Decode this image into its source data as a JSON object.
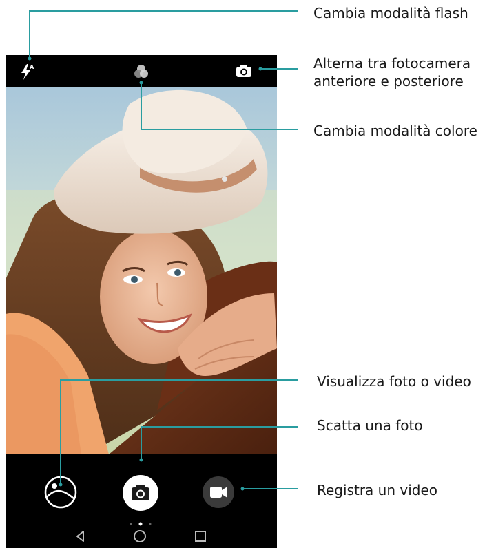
{
  "callouts": {
    "flash": "Cambia modalità flash",
    "switch_camera_line1": "Alterna tra fotocamera",
    "switch_camera_line2": "anteriore e posteriore",
    "color_mode": "Cambia modalità colore",
    "gallery": "Visualizza foto o video",
    "shutter": "Scatta una foto",
    "video": "Registra un video"
  },
  "toolbar": {
    "flash_icon": "flash-auto-icon",
    "flash_mode_badge": "A",
    "color_icon": "color-filter-icon",
    "switch_icon": "switch-camera-icon"
  },
  "controls": {
    "gallery_icon": "gallery-thumbnail-icon",
    "shutter_icon": "camera-icon",
    "video_icon": "video-camera-icon"
  },
  "navigation": [
    "back-icon",
    "home-icon",
    "recents-icon"
  ],
  "colors": {
    "callout_line": "#2a9da0",
    "bar_background": "#000000",
    "shutter_fill": "#ffffff",
    "video_button": "#3a3a3a"
  }
}
